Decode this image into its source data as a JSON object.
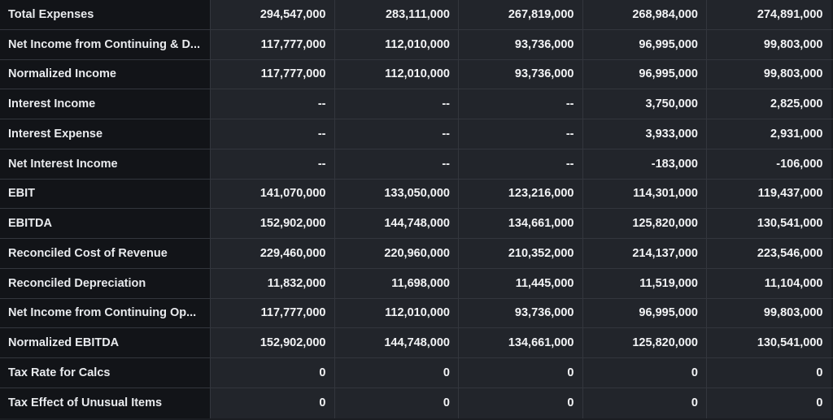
{
  "rows": [
    {
      "label": "Total Expenses",
      "values": [
        "294,547,000",
        "283,111,000",
        "267,819,000",
        "268,984,000",
        "274,891,000"
      ]
    },
    {
      "label": "Net Income from Continuing & D...",
      "values": [
        "117,777,000",
        "112,010,000",
        "93,736,000",
        "96,995,000",
        "99,803,000"
      ]
    },
    {
      "label": "Normalized Income",
      "values": [
        "117,777,000",
        "112,010,000",
        "93,736,000",
        "96,995,000",
        "99,803,000"
      ]
    },
    {
      "label": "Interest Income",
      "values": [
        "--",
        "--",
        "--",
        "3,750,000",
        "2,825,000"
      ]
    },
    {
      "label": "Interest Expense",
      "values": [
        "--",
        "--",
        "--",
        "3,933,000",
        "2,931,000"
      ]
    },
    {
      "label": "Net Interest Income",
      "values": [
        "--",
        "--",
        "--",
        "-183,000",
        "-106,000"
      ]
    },
    {
      "label": "EBIT",
      "values": [
        "141,070,000",
        "133,050,000",
        "123,216,000",
        "114,301,000",
        "119,437,000"
      ]
    },
    {
      "label": "EBITDA",
      "values": [
        "152,902,000",
        "144,748,000",
        "134,661,000",
        "125,820,000",
        "130,541,000"
      ]
    },
    {
      "label": "Reconciled Cost of Revenue",
      "values": [
        "229,460,000",
        "220,960,000",
        "210,352,000",
        "214,137,000",
        "223,546,000"
      ]
    },
    {
      "label": "Reconciled Depreciation",
      "values": [
        "11,832,000",
        "11,698,000",
        "11,445,000",
        "11,519,000",
        "11,104,000"
      ]
    },
    {
      "label": "Net Income from Continuing Op...",
      "values": [
        "117,777,000",
        "112,010,000",
        "93,736,000",
        "96,995,000",
        "99,803,000"
      ]
    },
    {
      "label": "Normalized EBITDA",
      "values": [
        "152,902,000",
        "144,748,000",
        "134,661,000",
        "125,820,000",
        "130,541,000"
      ]
    },
    {
      "label": "Tax Rate for Calcs",
      "values": [
        "0",
        "0",
        "0",
        "0",
        "0"
      ]
    },
    {
      "label": "Tax Effect of Unusual Items",
      "values": [
        "0",
        "0",
        "0",
        "0",
        "0"
      ]
    }
  ]
}
